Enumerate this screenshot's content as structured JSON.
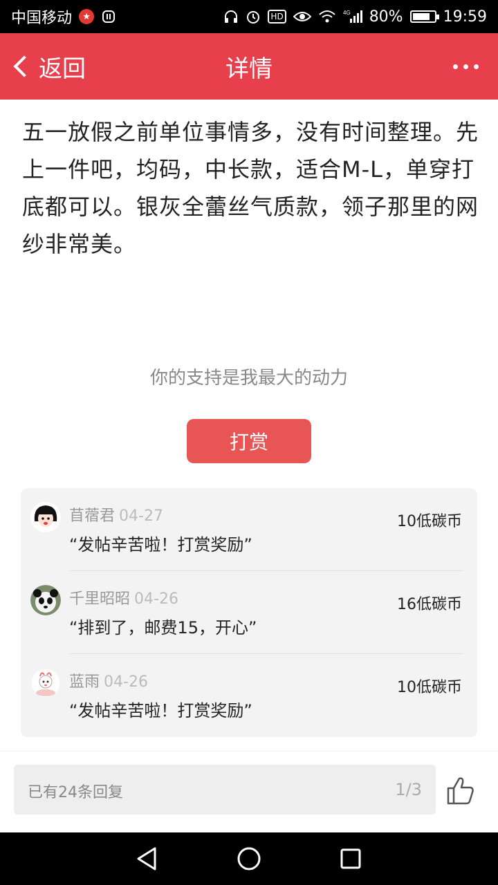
{
  "status_bar": {
    "carrier": "中国移动",
    "battery": "80%",
    "battery_level": 0.8,
    "time": "19:59",
    "network": "4G",
    "hd": "HD",
    "icons": [
      "star-badge-icon",
      "notification-icon",
      "headset-icon",
      "alarm-icon",
      "hd-icon",
      "eye-icon",
      "wifi-icon",
      "signal-icon",
      "battery-icon"
    ]
  },
  "header": {
    "back_label": "返回",
    "title": "详情"
  },
  "post": {
    "body": "五一放假之前单位事情多，没有时间整理。先上一件吧，均码，中长款，适合M-L，单穿打底都可以。银灰全蕾丝气质款，领子那里的网纱非常美。"
  },
  "support": {
    "text": "你的支持是我最大的动力",
    "button": "打赏"
  },
  "tips": [
    {
      "name": "苜蓿君",
      "date": "04-27",
      "message": "“发帖辛苦啦！打赏奖励”",
      "amount": "10低碳币",
      "avatar": "girl-avatar"
    },
    {
      "name": "千里昭昭",
      "date": "04-26",
      "message": "“排到了，邮费15，开心”",
      "amount": "16低碳币",
      "avatar": "panda-avatar"
    },
    {
      "name": "蓝雨",
      "date": "04-26",
      "message": "“发帖辛苦啦！打赏奖励”",
      "amount": "10低碳币",
      "avatar": "cartoon-avatar"
    }
  ],
  "reply_bar": {
    "placeholder": "已有24条回复",
    "page": "1/3"
  },
  "colors": {
    "brand": "#e83f4c",
    "tip_button": "#e85555"
  }
}
